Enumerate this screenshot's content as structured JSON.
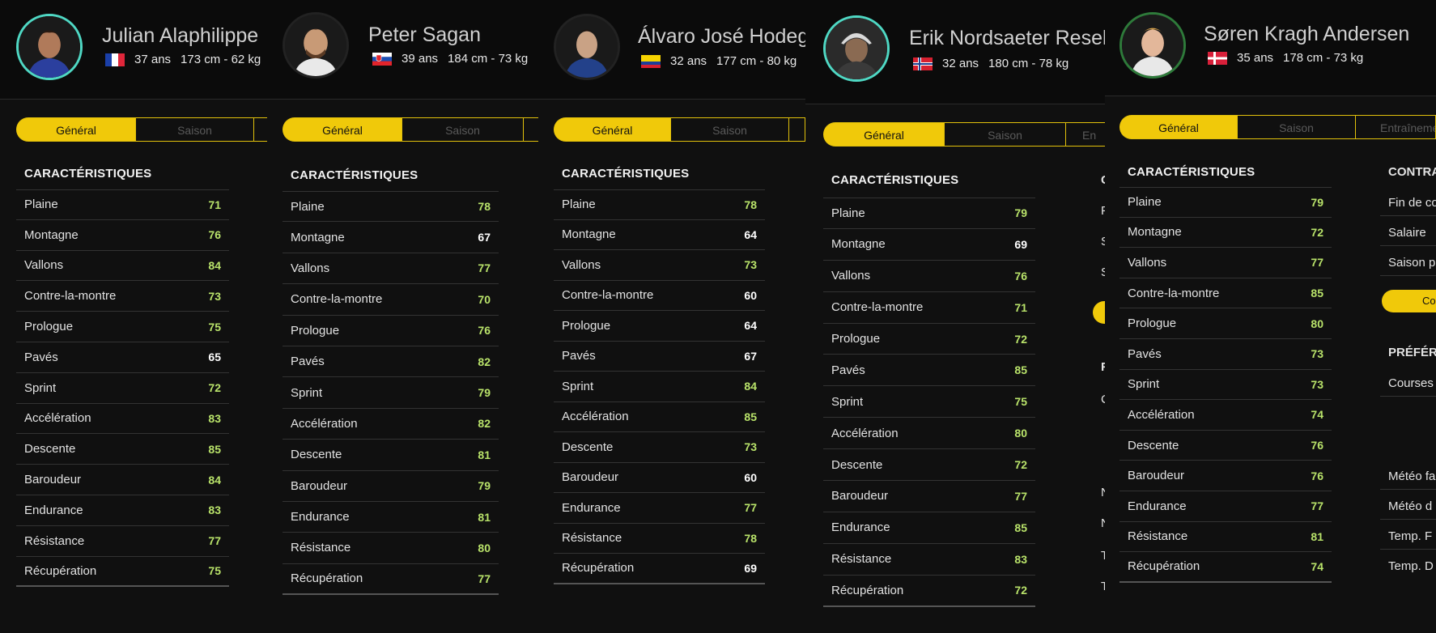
{
  "tabs": {
    "general": "Général",
    "season": "Saison",
    "training": "Entraînement",
    "training_short": "En"
  },
  "section_title": "CARACTÉRISTIQUES",
  "riders": [
    {
      "name": "Julian Alaphilippe",
      "age": "37 ans",
      "measures": "173 cm - 62 kg",
      "flag": "france",
      "stats": [
        [
          "Plaine",
          "71"
        ],
        [
          "Montagne",
          "76"
        ],
        [
          "Vallons",
          "84"
        ],
        [
          "Contre-la-montre",
          "73"
        ],
        [
          "Prologue",
          "75"
        ],
        [
          "Pavés",
          "65"
        ],
        [
          "Sprint",
          "72"
        ],
        [
          "Accélération",
          "83"
        ],
        [
          "Descente",
          "85"
        ],
        [
          "Baroudeur",
          "84"
        ],
        [
          "Endurance",
          "83"
        ],
        [
          "Résistance",
          "77"
        ],
        [
          "Récupération",
          "75"
        ]
      ]
    },
    {
      "name": "Peter Sagan",
      "age": "39 ans",
      "measures": "184 cm - 73 kg",
      "flag": "slovakia",
      "stats": [
        [
          "Plaine",
          "78"
        ],
        [
          "Montagne",
          "67"
        ],
        [
          "Vallons",
          "77"
        ],
        [
          "Contre-la-montre",
          "70"
        ],
        [
          "Prologue",
          "76"
        ],
        [
          "Pavés",
          "82"
        ],
        [
          "Sprint",
          "79"
        ],
        [
          "Accélération",
          "82"
        ],
        [
          "Descente",
          "81"
        ],
        [
          "Baroudeur",
          "79"
        ],
        [
          "Endurance",
          "81"
        ],
        [
          "Résistance",
          "80"
        ],
        [
          "Récupération",
          "77"
        ]
      ]
    },
    {
      "name": "Álvaro José Hodeg",
      "age": "32 ans",
      "measures": "177 cm - 80 kg",
      "flag": "colombia",
      "stats": [
        [
          "Plaine",
          "78"
        ],
        [
          "Montagne",
          "64"
        ],
        [
          "Vallons",
          "73"
        ],
        [
          "Contre-la-montre",
          "60"
        ],
        [
          "Prologue",
          "64"
        ],
        [
          "Pavés",
          "67"
        ],
        [
          "Sprint",
          "84"
        ],
        [
          "Accélération",
          "85"
        ],
        [
          "Descente",
          "73"
        ],
        [
          "Baroudeur",
          "60"
        ],
        [
          "Endurance",
          "77"
        ],
        [
          "Résistance",
          "78"
        ],
        [
          "Récupération",
          "69"
        ]
      ]
    },
    {
      "name": "Erik Nordsaeter Resell",
      "age": "32 ans",
      "measures": "180 cm - 78 kg",
      "flag": "norway",
      "stats": [
        [
          "Plaine",
          "79"
        ],
        [
          "Montagne",
          "69"
        ],
        [
          "Vallons",
          "76"
        ],
        [
          "Contre-la-montre",
          "71"
        ],
        [
          "Prologue",
          "72"
        ],
        [
          "Pavés",
          "85"
        ],
        [
          "Sprint",
          "75"
        ],
        [
          "Accélération",
          "80"
        ],
        [
          "Descente",
          "72"
        ],
        [
          "Baroudeur",
          "77"
        ],
        [
          "Endurance",
          "85"
        ],
        [
          "Résistance",
          "83"
        ],
        [
          "Récupération",
          "72"
        ]
      ]
    },
    {
      "name": "Søren Kragh Andersen",
      "age": "35 ans",
      "measures": "178 cm - 73 kg",
      "flag": "denmark",
      "stats": [
        [
          "Plaine",
          "79"
        ],
        [
          "Montagne",
          "72"
        ],
        [
          "Vallons",
          "77"
        ],
        [
          "Contre-la-montre",
          "85"
        ],
        [
          "Prologue",
          "80"
        ],
        [
          "Pavés",
          "73"
        ],
        [
          "Sprint",
          "73"
        ],
        [
          "Accélération",
          "74"
        ],
        [
          "Descente",
          "76"
        ],
        [
          "Baroudeur",
          "76"
        ],
        [
          "Endurance",
          "77"
        ],
        [
          "Résistance",
          "81"
        ],
        [
          "Récupération",
          "74"
        ]
      ]
    }
  ],
  "erik_extra": {
    "letters": [
      "C",
      "F",
      "S",
      "S",
      "F",
      "C",
      "N",
      "N",
      "T",
      "T"
    ]
  },
  "soren_extra": {
    "contract_title": "CONTRA",
    "rows": [
      "Fin de co",
      "Salaire",
      "Saison p"
    ],
    "button": "Co",
    "pref_title": "PRÉFÉR",
    "pref_row": "Courses",
    "weather": [
      "Météo fa",
      "Météo d",
      "Temp. F",
      "Temp. D"
    ]
  },
  "colors": {
    "accent": "#f0c90a",
    "high": "#b9e36a",
    "normal": "#ffffff"
  }
}
